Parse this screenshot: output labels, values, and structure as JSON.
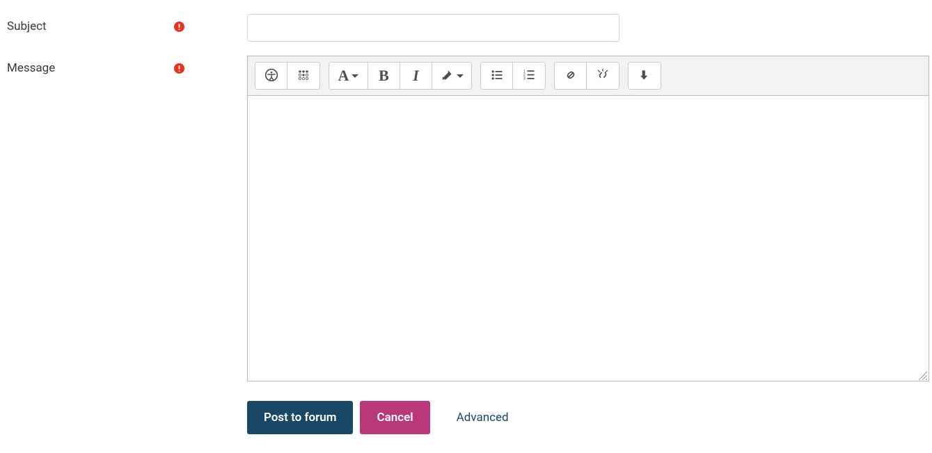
{
  "fields": {
    "subject": {
      "label": "Subject",
      "value": "",
      "required": true
    },
    "message": {
      "label": "Message",
      "value": "",
      "required": true
    }
  },
  "toolbar": {
    "accessibility_icon": "accessibility",
    "braille_icon": "screenreader-helper",
    "paragraph_style": "A",
    "bold": "B",
    "italic": "I",
    "brush": "brush",
    "ul": "unordered-list",
    "ol": "ordered-list",
    "link": "link",
    "unlink": "unlink",
    "expand": "show-more"
  },
  "actions": {
    "submit": "Post to forum",
    "cancel": "Cancel",
    "advanced": "Advanced"
  },
  "colors": {
    "primary": "#194866",
    "secondary": "#b9387a",
    "required": "#e83224"
  }
}
